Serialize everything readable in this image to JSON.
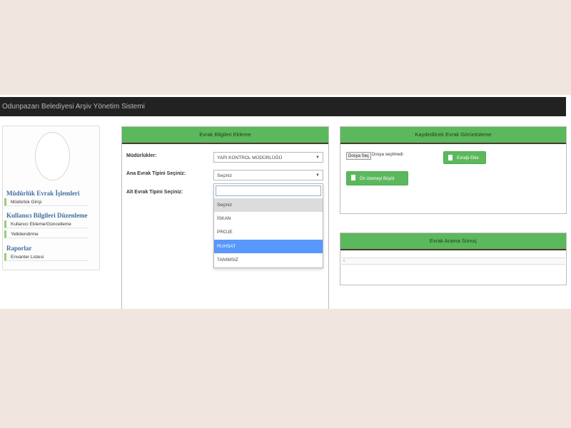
{
  "app": {
    "title": "Odunpazarı Belediyesi Arşiv Yönetim Sistemi"
  },
  "sidebar": {
    "sections": [
      {
        "title": "Müdürlük Evrak İşlemleri",
        "items": [
          {
            "label": "Müdürlük Girişi"
          }
        ]
      },
      {
        "title": "Kullanıcı Bilgileri Düzenleme",
        "items": [
          {
            "label": "Kullanıcı Ekleme/Güncelleme"
          },
          {
            "label": "Yetkilendirme"
          }
        ]
      },
      {
        "title": "Raporlar",
        "items": [
          {
            "label": "Envanter Listesi"
          }
        ]
      }
    ]
  },
  "form_panel": {
    "title": "Evrak Bilgileri Ekleme",
    "fields": [
      {
        "label": "Müdürlükler:",
        "value": "YAPI KONTROL MÜDÜRLÜĞÜ"
      },
      {
        "label": "Ana Evrak Tipini Seçiniz:",
        "value": "Seçiniz"
      },
      {
        "label": "Alt Evrak Tipini Seçiniz:"
      }
    ],
    "dropdown": {
      "search_value": "",
      "options": [
        "Seçiniz",
        "İSKAN",
        "PROJE",
        "RUHSAT",
        "TANIMSIZ"
      ],
      "selected_index": 0,
      "highlighted_index": 3
    }
  },
  "view_panel": {
    "title": "Kaydedilcek Evrak Görüntüleme",
    "file_button": "Dosya Seç",
    "file_status": "Dosya seçilmedi",
    "add_button": "Evrağı Ekle",
    "preview_button": "Ön izlemeyi Büyüt"
  },
  "result_panel": {
    "title": "Evrak Arama Sonuç",
    "row_text": "‹"
  },
  "colors": {
    "accent_green": "#5cb85c",
    "topbar": "#222222",
    "highlight_blue": "#5897fb",
    "section_blue": "#3f6fa0"
  }
}
